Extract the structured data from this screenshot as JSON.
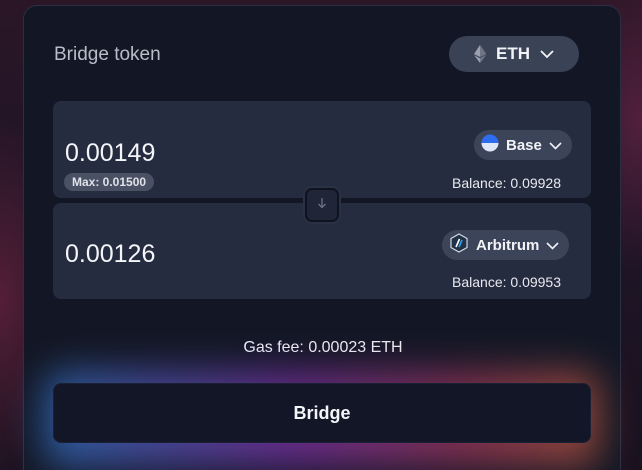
{
  "header": {
    "title": "Bridge token",
    "token_label": "ETH",
    "token_icon": "eth-icon"
  },
  "from": {
    "amount": "0.00149",
    "max_label": "Max: 0.01500",
    "chain_label": "Base",
    "chain_icon": "base-chain-icon",
    "balance": "Balance: 0.09928"
  },
  "to": {
    "amount": "0.00126",
    "chain_label": "Arbitrum",
    "chain_icon": "arbitrum-chain-icon",
    "balance": "Balance: 0.09953"
  },
  "gas": {
    "text": "Gas fee: 0.00023 ETH"
  },
  "action": {
    "bridge_label": "Bridge"
  },
  "colors": {
    "card_bg": "#131725",
    "panel_bg": "#262c40",
    "pill_bg": "#3a4256",
    "base_blue": "#2f6df0"
  }
}
